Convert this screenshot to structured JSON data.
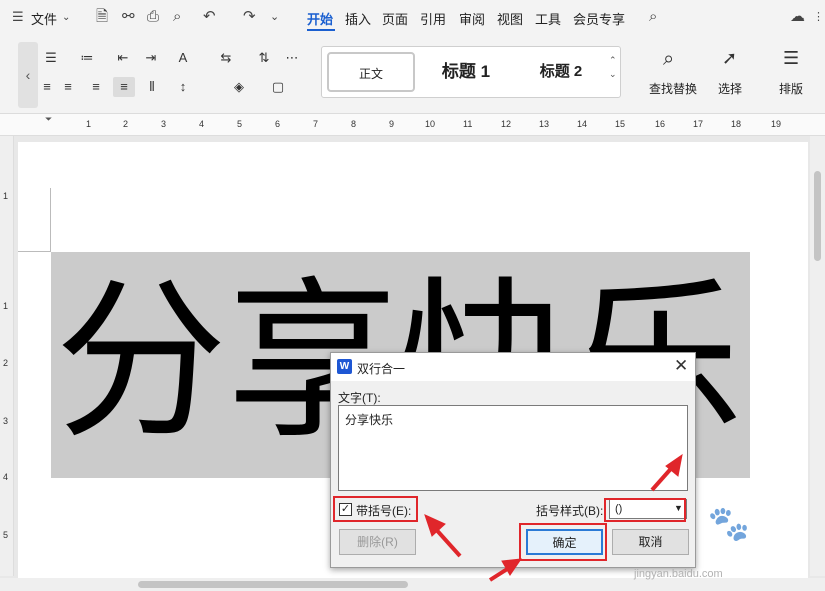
{
  "menubar": {
    "file": "文件",
    "tabs": [
      "开始",
      "插入",
      "页面",
      "引用",
      "审阅",
      "视图",
      "工具",
      "会员专享"
    ]
  },
  "ribbon": {
    "styles": [
      "正文",
      "标题 1",
      "标题 2"
    ],
    "find_replace": "查找替换",
    "select": "选择",
    "layout": "排版"
  },
  "ruler": {
    "marks": [
      "1",
      "2",
      "3",
      "4",
      "5",
      "6",
      "7",
      "8",
      "9",
      "10",
      "11",
      "12",
      "13",
      "14",
      "15",
      "16",
      "17",
      "18",
      "19"
    ],
    "v_marks": [
      "1",
      "1",
      "2",
      "3",
      "4",
      "5"
    ]
  },
  "document": {
    "text": "分享快乐"
  },
  "dialog": {
    "title": "双行合一",
    "text_label": "文字(T):",
    "text_value": "分享快乐",
    "with_brackets_label": "带括号(E):",
    "with_brackets_checked": true,
    "bracket_style_label": "括号样式(B):",
    "bracket_style_value": "()",
    "delete_button": "删除(R)",
    "ok_button": "确定",
    "cancel_button": "取消"
  },
  "watermark": "jingyan.baidu.com"
}
